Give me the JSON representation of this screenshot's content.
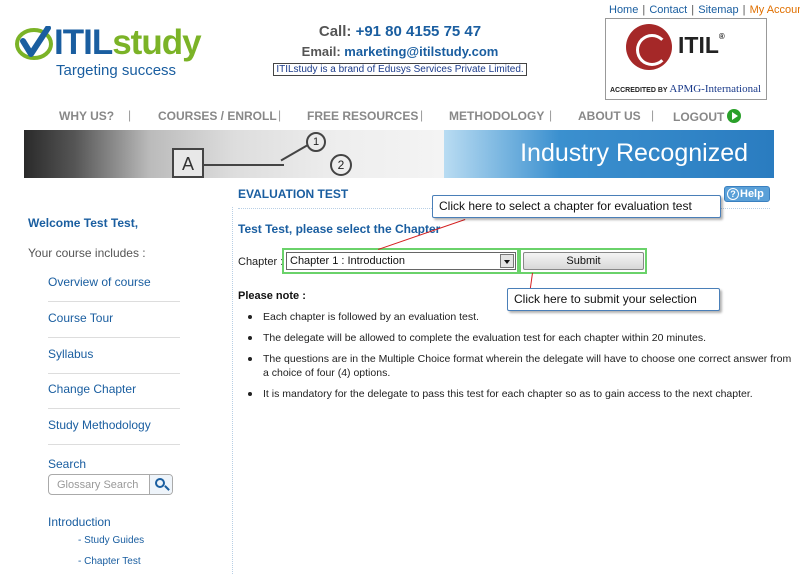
{
  "header": {
    "logo_word_1": "ITIL",
    "logo_word_2": "study",
    "logo_tagline": "Targeting success",
    "call_label": "Call: ",
    "call_number": "+91 80 4155 75 47",
    "email_label": "Email: ",
    "email_address": "marketing@itilstudy.com",
    "brand_note": "ITILstudy is a brand of Edusys Services Private Limited.",
    "top_links": [
      "Home",
      "Contact",
      "Sitemap",
      "My Account"
    ],
    "badge_text": "ITIL",
    "badge_reg": "®",
    "badge_accredited": "ACCREDITED BY",
    "badge_apmg": "APMG-International",
    "colors": {
      "brand_blue": "#1a5ea0",
      "brand_green": "#7bb327",
      "account_orange": "#e07000"
    }
  },
  "nav": {
    "items": [
      "WHY US?",
      "COURSES / ENROLL",
      "FREE RESOURCES",
      "METHODOLOGY",
      "ABOUT US",
      "LOGOUT"
    ],
    "separator": "|"
  },
  "banner": {
    "text": "Industry Recognized",
    "diagram_box": "A",
    "diagram_c1": "1",
    "diagram_c2": "2"
  },
  "sidebar": {
    "welcome": "Welcome Test Test,",
    "includes": "Your course includes :",
    "links": [
      "Overview of course",
      "Course Tour",
      "Syllabus",
      "Change Chapter",
      "Study Methodology"
    ],
    "search_label": "Search",
    "search_placeholder": "Glossary Search",
    "section_head": "Introduction",
    "sub_links": [
      "- Study Guides",
      "- Chapter Test"
    ]
  },
  "main": {
    "title": "EVALUATION TEST",
    "help_label": "Help",
    "help_icon": "?",
    "select_prompt": "Test Test, please select the Chapter",
    "chapter_label": "Chapter :",
    "chapter_selected": "Chapter 1 : Introduction",
    "submit_label": "Submit",
    "note_head": "Please note :",
    "notes": [
      "Each chapter is followed by an evaluation test.",
      "The delegate will be allowed to complete the evaluation test for each chapter within 20 minutes.",
      "The questions are in the Multiple Choice format wherein the delegate will have to choose one correct answer from a choice of four (4) options.",
      "It is mandatory for the delegate to pass this test for each chapter so as to gain access to the next chapter."
    ]
  },
  "callouts": {
    "select_hint": "Click here to select a chapter for evaluation test",
    "submit_hint": "Click here to submit your selection"
  }
}
